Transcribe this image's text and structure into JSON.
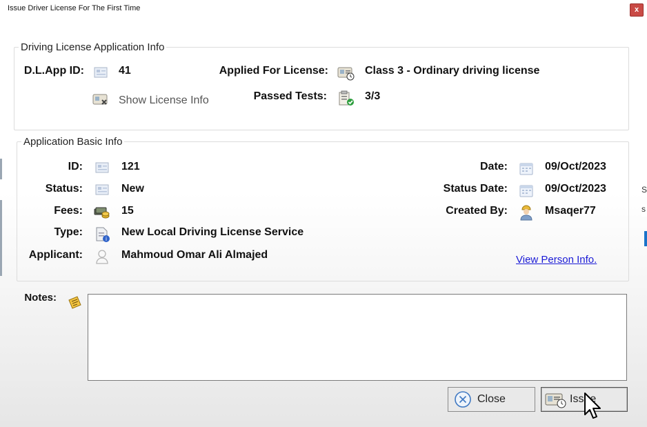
{
  "window": {
    "title": "Issue Driver License For The First Time",
    "close_glyph": "x"
  },
  "background_fragments": {
    "edge_right_1": "S",
    "edge_right_2": "s"
  },
  "license_app_info": {
    "legend": "Driving License Application Info",
    "dl_app_id_label": "D.L.App ID:",
    "dl_app_id": "41",
    "applied_for_label": "Applied For License:",
    "applied_for": "Class 3 - Ordinary driving license",
    "show_license_info": "Show License Info",
    "passed_tests_label": "Passed Tests:",
    "passed_tests": "3/3"
  },
  "application_basic_info": {
    "legend": "Application Basic Info",
    "id_label": "ID:",
    "id": "121",
    "status_label": "Status:",
    "status": "New",
    "fees_label": "Fees:",
    "fees": "15",
    "type_label": "Type:",
    "type": "New Local Driving License Service",
    "applicant_label": "Applicant:",
    "applicant": "Mahmoud Omar Ali Almajed",
    "date_label": "Date:",
    "date": "09/Oct/2023",
    "status_date_label": "Status Date:",
    "status_date": "09/Oct/2023",
    "created_by_label": "Created By:",
    "created_by": "Msaqer77",
    "view_person_info": "View Person Info."
  },
  "notes": {
    "label": "Notes:",
    "value": ""
  },
  "buttons": {
    "close": "Close",
    "issue": "Issue"
  },
  "icons": {
    "id": "id-card-icon",
    "license": "license-card-icon",
    "show_license": "license-view-icon",
    "tests": "passed-tests-icon",
    "fees": "money-icon",
    "type": "document-icon",
    "applicant": "person-icon",
    "date": "calendar-icon",
    "created_by": "user-icon",
    "notes": "notes-icon",
    "close": "close-circle-icon",
    "issue": "license-issue-icon"
  }
}
